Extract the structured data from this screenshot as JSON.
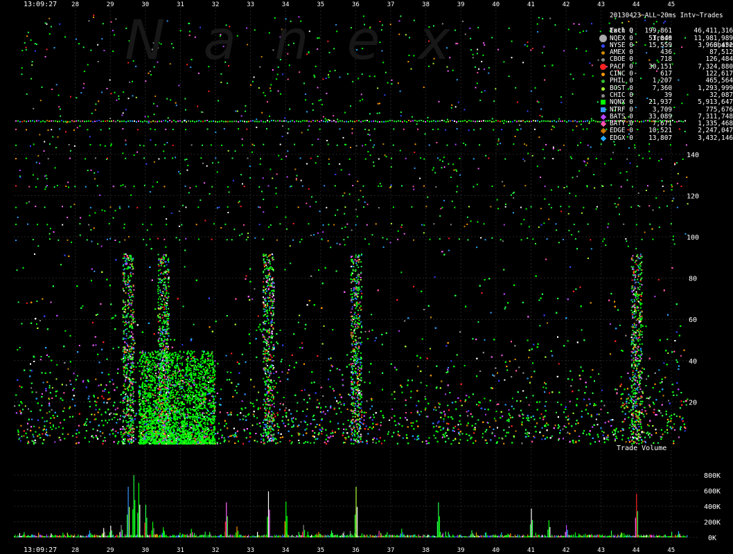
{
  "watermark": "Nanex",
  "legend": {
    "title": "20130423~ALL~20ms Intv~Trades",
    "header": {
      "exch": "Exch Q",
      "trade": "Trade",
      "share": "Share"
    },
    "rows": [
      {
        "exch": "Totl 0",
        "trade": "199,861",
        "share": "46,411,316",
        "color": "#ffffff",
        "marker": "none"
      },
      {
        "exch": "NQEX 0",
        "trade": "53,040",
        "share": "11,981,989",
        "color": "#aaaaaa",
        "marker": "big-circle"
      },
      {
        "exch": "NYSE 0",
        "trade": "15,559",
        "share": "3,960,452",
        "color": "#3344ff",
        "marker": "dot"
      },
      {
        "exch": "AMEX 0",
        "trade": "436",
        "share": "87,512",
        "color": "#cc8800",
        "marker": "dot"
      },
      {
        "exch": "CBOE 0",
        "trade": "718",
        "share": "126,484",
        "color": "#888888",
        "marker": "dot"
      },
      {
        "exch": "PACF 0",
        "trade": "30,151",
        "share": "7,324,880",
        "color": "#ff2222",
        "marker": "circle"
      },
      {
        "exch": "CINC 0",
        "trade": "617",
        "share": "122,617",
        "color": "#ff9900",
        "marker": "dot"
      },
      {
        "exch": "PHIL 0",
        "trade": "1,207",
        "share": "465,564",
        "color": "#33bb33",
        "marker": "dot"
      },
      {
        "exch": "BOST 0",
        "trade": "7,360",
        "share": "1,293,999",
        "color": "#aaff33",
        "marker": "dot"
      },
      {
        "exch": "CHIC 0",
        "trade": "39",
        "share": "32,087",
        "color": "#888888",
        "marker": "dot"
      },
      {
        "exch": "NQNX 0",
        "trade": "21,937",
        "share": "5,913,647",
        "color": "#00ff00",
        "marker": "square"
      },
      {
        "exch": "NTRF 0",
        "trade": "3,709",
        "share": "775,676",
        "color": "#3399ff",
        "marker": "square"
      },
      {
        "exch": "BATS 0",
        "trade": "33,089",
        "share": "7,311,748",
        "color": "#bb44ff",
        "marker": "diamond"
      },
      {
        "exch": "BATY 0",
        "trade": "7,671",
        "share": "1,335,468",
        "color": "#ff55aa",
        "marker": "diamond"
      },
      {
        "exch": "EDGE 0",
        "trade": "10,521",
        "share": "2,247,047",
        "color": "#cc7700",
        "marker": "diamond"
      },
      {
        "exch": "EDGX 0",
        "trade": "13,807",
        "share": "3,432,146",
        "color": "#22aaff",
        "marker": "diamond"
      }
    ]
  },
  "chart_data": [
    {
      "type": "scatter",
      "title": "20130423~ALL~20ms Intv~Trades",
      "xlabel": "",
      "ylabel": "",
      "x_start_label": "13:09:27",
      "x_ticks": [
        "28",
        "29",
        "30",
        "31",
        "32",
        "33",
        "34",
        "35",
        "36",
        "37",
        "38",
        "39",
        "40",
        "41",
        "42",
        "43",
        "44",
        "45"
      ],
      "y_ticks": [
        "20",
        "40",
        "60",
        "80",
        "100",
        "120",
        "140"
      ],
      "ylim": [
        0,
        150
      ],
      "grid": true,
      "note_visible": "dense scatter of trade sizes per 20ms interval, colored by exchange",
      "hot_seconds": [
        29.5,
        30.5,
        33.5,
        36,
        44
      ],
      "stripes_y": [
        92,
        101,
        108,
        116,
        127,
        138,
        148,
        157
      ]
    },
    {
      "type": "bar",
      "title": "Trade Volume",
      "y_ticks": [
        "0K",
        "200K",
        "400K",
        "600K",
        "800K"
      ],
      "ylim": [
        0,
        800000
      ],
      "peaks": [
        {
          "x": 28.4,
          "value": 90000
        },
        {
          "x": 28.8,
          "value": 120000
        },
        {
          "x": 29.0,
          "value": 150000
        },
        {
          "x": 29.3,
          "value": 160000
        },
        {
          "x": 29.5,
          "value": 650000
        },
        {
          "x": 29.66,
          "value": 800000
        },
        {
          "x": 29.8,
          "value": 700000
        },
        {
          "x": 30.0,
          "value": 420000
        },
        {
          "x": 30.2,
          "value": 200000
        },
        {
          "x": 30.5,
          "value": 130000
        },
        {
          "x": 31.3,
          "value": 110000
        },
        {
          "x": 32.3,
          "value": 450000
        },
        {
          "x": 32.6,
          "value": 140000
        },
        {
          "x": 33.5,
          "value": 590000
        },
        {
          "x": 34.0,
          "value": 460000
        },
        {
          "x": 34.5,
          "value": 160000
        },
        {
          "x": 35.3,
          "value": 90000
        },
        {
          "x": 36.0,
          "value": 650000
        },
        {
          "x": 37.3,
          "value": 110000
        },
        {
          "x": 38.35,
          "value": 450000
        },
        {
          "x": 39.3,
          "value": 90000
        },
        {
          "x": 41.0,
          "value": 370000
        },
        {
          "x": 41.5,
          "value": 220000
        },
        {
          "x": 42.0,
          "value": 160000
        },
        {
          "x": 44.0,
          "value": 560000
        },
        {
          "x": 45.2,
          "value": 80000
        }
      ]
    }
  ]
}
